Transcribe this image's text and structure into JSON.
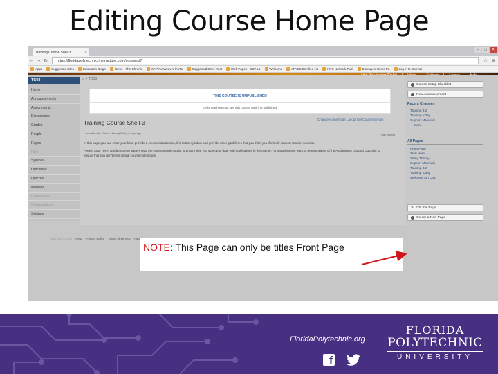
{
  "slide": {
    "title": "Editing Course Home Page"
  },
  "browser": {
    "tab_title": "Training Course Shel-3",
    "url": "https://floridapolytechnic.instructure.com/courses/7",
    "bookmarks": [
      "Apps",
      "Suggested Sites",
      "Education Blogs",
      "Home - The Chronic",
      "SAP NetWeaver Portal",
      "Suggested Sites Rest",
      "Web Pages - CSP Lo",
      "Welcome",
      "eFACS Enrollee Ho",
      "KRS Network Publ",
      "Employee Home Pa",
      "Log in to Canvas"
    ]
  },
  "canvas": {
    "logo": {
      "line1": "FLORIDA",
      "line2": "POLYTECHNIC",
      "line3": "UNIVERSITY"
    },
    "user_bar": [
      "Unit Dev Master (Rolls)",
      "Inbox",
      "Settings",
      "Logout",
      "Help"
    ],
    "main_nav": [
      "Courses",
      "Assignments",
      "Grades",
      "Calendar",
      "Library"
    ],
    "course_code": "TC03",
    "breadcrumb": "TC03",
    "left_nav": [
      {
        "label": "Home",
        "dim": false
      },
      {
        "label": "Announcements",
        "dim": false
      },
      {
        "label": "Assignments",
        "dim": false
      },
      {
        "label": "Discussions",
        "dim": false
      },
      {
        "label": "Grades",
        "dim": false
      },
      {
        "label": "People",
        "dim": false
      },
      {
        "label": "Pages",
        "dim": false
      },
      {
        "label": "Files",
        "dim": true
      },
      {
        "label": "Syllabus",
        "dim": false
      },
      {
        "label": "Outcomes",
        "dim": false
      },
      {
        "label": "Quizzes",
        "dim": false
      },
      {
        "label": "Modules",
        "dim": false
      },
      {
        "label": "Conferences",
        "dim": true
      },
      {
        "label": "Collaborations",
        "dim": true
      },
      {
        "label": "Settings",
        "dim": false
      }
    ],
    "unpublished": {
      "heading": "THIS COURSE IS UNPUBLISHED",
      "message": "Only teachers can see this course until it is published"
    },
    "page": {
      "title": "Training Course Shell-3",
      "links": "Change Home Page Layout  Get Course Stream",
      "last_edited": "Last edited by Online Master(Rolls) 4 days ago",
      "history": "Page history",
      "para1": "In this page you can enter your bios, provide a course introduction, link to the syllabus and provide other guidelines that you think you think will support student success.",
      "para2": "Please Start Here, and be sure to always read the Announcements List to ensure that you stay up to date with notifications in the course. As a student you want to remain aware of the Assignment List and Quiz List to ensure that you don't miss critical course milestones."
    },
    "sidebar": {
      "setup_checklist": "Course Setup Checklist",
      "new_announcement": "New Announcement",
      "recent_changes_heading": "Recent Changes",
      "recent_changes": [
        {
          "label": "Training 4.2",
          "sub": false
        },
        {
          "label": "Training today",
          "sub": false
        },
        {
          "label": "Support Materials",
          "sub": false
        },
        {
          "label": "more",
          "sub": true
        }
      ],
      "all_pages_heading": "All Pages",
      "all_pages": [
        "Front Page",
        "Start Here",
        "String Theory",
        "Support Materials",
        "Training 4.2",
        "Training today",
        "Welcome to TC03"
      ],
      "edit_page": "Edit this Page",
      "create_page": "Create a New Page"
    },
    "footer": [
      "INSTRUCTURE",
      "Help",
      "Privacy policy",
      "Terms of service",
      "Facebook",
      "Twitter"
    ]
  },
  "note": {
    "label": "NOTE",
    "text": ": This Page can only be titles Front Page"
  },
  "banner": {
    "site": "FloridaPolytechnic.org",
    "brand_line1": "FLORIDA",
    "brand_line2": "POLYTECHNIC",
    "brand_line3": "UNIVERSITY",
    "brand_color": "#472f82",
    "accent_red": "#d0171c"
  }
}
